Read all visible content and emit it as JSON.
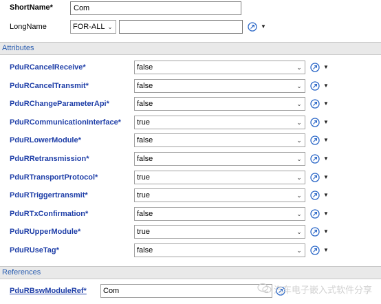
{
  "header": {
    "short_name_label": "ShortName*",
    "short_name_value": "Com",
    "long_name_label": "LongName",
    "long_name_lang": "FOR-ALL",
    "long_name_value": ""
  },
  "attributes": {
    "section_title": "Attributes",
    "rows": [
      {
        "name": "PduRCancelReceive*",
        "value": "false"
      },
      {
        "name": "PduRCancelTransmit*",
        "value": "false"
      },
      {
        "name": "PduRChangeParameterApi*",
        "value": "false"
      },
      {
        "name": "PduRCommunicationInterface*",
        "value": "true"
      },
      {
        "name": "PduRLowerModule*",
        "value": "false"
      },
      {
        "name": "PduRRetransmission*",
        "value": "false"
      },
      {
        "name": "PduRTransportProtocol*",
        "value": "true"
      },
      {
        "name": "PduRTriggertransmit*",
        "value": "true"
      },
      {
        "name": "PduRTxConfirmation*",
        "value": "false"
      },
      {
        "name": "PduRUpperModule*",
        "value": "true"
      },
      {
        "name": "PduRUseTag*",
        "value": "false"
      }
    ]
  },
  "references": {
    "section_title": "References",
    "rows": [
      {
        "name": "PduRBswModuleRef*",
        "value": "Com"
      }
    ]
  },
  "watermark": "汽车电子嵌入式软件分享",
  "icons": {
    "reset": "reset-icon",
    "dropdown": "chevron-down-icon",
    "watermark_logo": "wechat-logo-icon"
  }
}
